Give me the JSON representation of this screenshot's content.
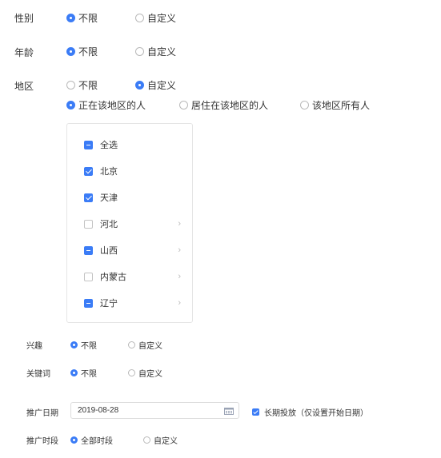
{
  "gender": {
    "label": "性别",
    "options": [
      "不限",
      "自定义"
    ],
    "selected": "不限"
  },
  "age": {
    "label": "年龄",
    "options": [
      "不限",
      "自定义"
    ],
    "selected": "不限"
  },
  "region": {
    "label": "地区",
    "options": [
      "不限",
      "自定义"
    ],
    "selected": "自定义",
    "scope_options": [
      "正在该地区的人",
      "居住在该地区的人",
      "该地区所有人"
    ],
    "scope_selected": "正在该地区的人",
    "tree": [
      {
        "label": "全选",
        "state": "partial",
        "expandable": false
      },
      {
        "label": "北京",
        "state": "checked",
        "expandable": false
      },
      {
        "label": "天津",
        "state": "checked",
        "expandable": false
      },
      {
        "label": "河北",
        "state": "unchecked",
        "expandable": true
      },
      {
        "label": "山西",
        "state": "partial",
        "expandable": true
      },
      {
        "label": "内蒙古",
        "state": "unchecked",
        "expandable": true
      },
      {
        "label": "辽宁",
        "state": "partial",
        "expandable": true
      }
    ],
    "chevron": "›"
  },
  "interest": {
    "label": "兴趣",
    "options": [
      "不限",
      "自定义"
    ],
    "selected": "不限"
  },
  "keyword": {
    "label": "关键词",
    "options": [
      "不限",
      "自定义"
    ],
    "selected": "不限"
  },
  "promo_date": {
    "label": "推广日期",
    "value": "2019-08-28",
    "long_term_label": "长期投放（仅设置开始日期）",
    "long_term_checked": true
  },
  "promo_time": {
    "label": "推广时段",
    "options": [
      "全部时段",
      "自定义"
    ],
    "selected": "全部时段"
  },
  "colors": {
    "accent": "#3b7cf6",
    "border": "#dcdcdc"
  }
}
